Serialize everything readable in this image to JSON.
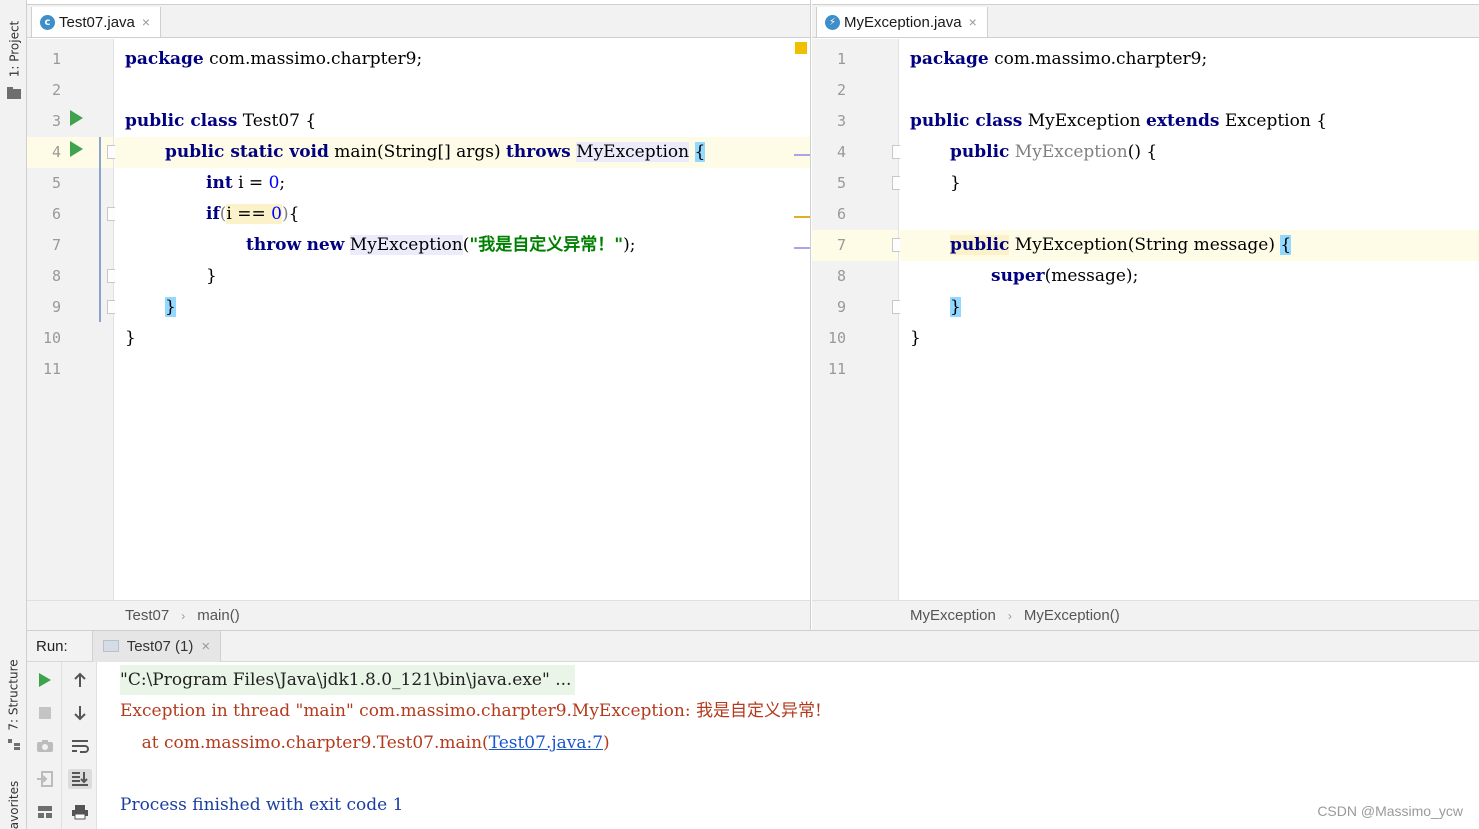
{
  "left_strip": {
    "project_label": "1: Project",
    "structure_label": "7: Structure",
    "favorites_label": "avorites"
  },
  "left_pane": {
    "tab": {
      "label": "Test07.java",
      "icon": "java-class-icon",
      "close": "×"
    },
    "lines": [
      {
        "n": "1"
      },
      {
        "n": "2"
      },
      {
        "n": "3"
      },
      {
        "n": "4"
      },
      {
        "n": "5"
      },
      {
        "n": "6"
      },
      {
        "n": "7"
      },
      {
        "n": "8"
      },
      {
        "n": "9"
      },
      {
        "n": "10"
      },
      {
        "n": "11"
      }
    ],
    "code": {
      "l1_kw": "package",
      "l1_rest": " com.massimo.charpter9;",
      "l3_kw": "public class",
      "l3_rest": " Test07 {",
      "l4_kw1": "public static void",
      "l4_main": " main(String[] args) ",
      "l4_kw2": "throws",
      "l4_sp": " ",
      "l4_exc": "MyException",
      "l4_sp2": " ",
      "l4_brace": "{",
      "l5_kw": "int",
      "l5_mid": " i = ",
      "l5_num": "0",
      "l5_end": ";",
      "l6_kw": "if",
      "l6_open": "(",
      "l6_cond": "i == ",
      "l6_num": "0",
      "l6_close": ")",
      "l6_end": "{",
      "l7_kw1": "throw",
      "l7_kw2": "new",
      "l7_exc": "MyException",
      "l7_open": "(",
      "l7_str": "\"我是自定义异常！\"",
      "l7_end": ");",
      "l8": "}",
      "l9_brace": "}",
      "l10": "}"
    },
    "breadcrumb": {
      "class": "Test07",
      "method": "main()",
      "sep": "›"
    }
  },
  "right_pane": {
    "tab": {
      "label": "MyException.java",
      "icon": "java-exception-class-icon",
      "close": "×"
    },
    "lines": [
      {
        "n": "1"
      },
      {
        "n": "2"
      },
      {
        "n": "3"
      },
      {
        "n": "4"
      },
      {
        "n": "5"
      },
      {
        "n": "6"
      },
      {
        "n": "7"
      },
      {
        "n": "8"
      },
      {
        "n": "9"
      },
      {
        "n": "10"
      },
      {
        "n": "11"
      }
    ],
    "code": {
      "l1_kw": "package",
      "l1_rest": " com.massimo.charpter9;",
      "l3_kw1": "public class",
      "l3_name": " MyException ",
      "l3_kw2": "extends",
      "l3_rest": " Exception {",
      "l4_kw": "public",
      "l4_name": " MyException",
      "l4_rest": "() {",
      "l5": "}",
      "l7_kw": "public",
      "l7_rest": " MyException(String message) ",
      "l7_brace": "{",
      "l8_kw": "super",
      "l8_rest": "(message);",
      "l9_brace": "}",
      "l10": "}"
    },
    "breadcrumb": {
      "class": "MyException",
      "method": "MyException()",
      "sep": "›"
    }
  },
  "run_panel": {
    "title": "Run:",
    "tab_label": "Test07 (1)",
    "tab_close": "×",
    "console": {
      "cmd": "\"C:\\Program Files\\Java\\jdk1.8.0_121\\bin\\java.exe\" ...",
      "exception": "Exception in thread \"main\" com.massimo.charpter9.MyException: 我是自定义异常!",
      "at_prefix": "    at com.massimo.charpter9.Test07.main(",
      "at_link": "Test07.java:7",
      "at_suffix": ")",
      "finished": "Process finished with exit code 1"
    }
  },
  "watermark": "CSDN @Massimo_ycw",
  "colors": {
    "keyword": "#000080",
    "string": "#008000",
    "number": "#0000ff",
    "error": "#b33a1c",
    "run_green": "#3fa34d",
    "link": "#1a55d0"
  }
}
